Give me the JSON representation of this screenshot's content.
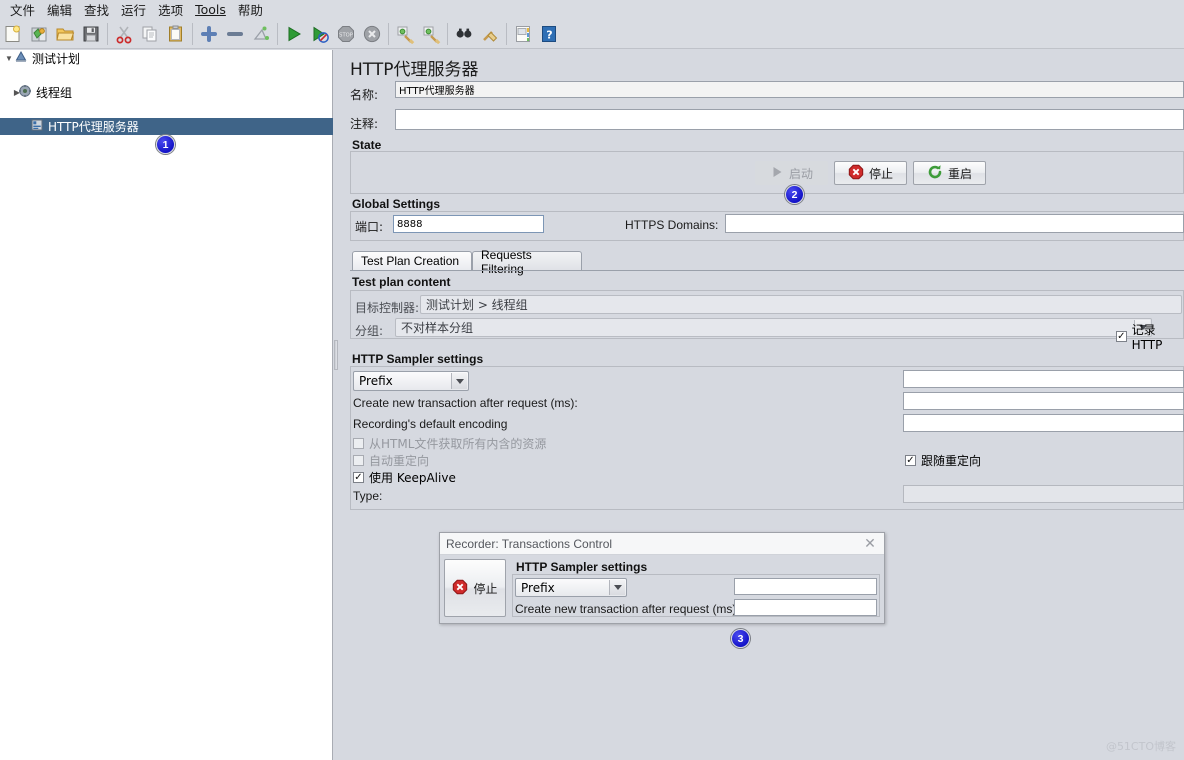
{
  "menu": {
    "items": [
      {
        "label": "文件"
      },
      {
        "label": "编辑"
      },
      {
        "label": "查找"
      },
      {
        "label": "运行"
      },
      {
        "label": "选项"
      },
      {
        "label": "Tools",
        "mnemonic": "T"
      },
      {
        "label": "帮助"
      }
    ]
  },
  "toolbar": {
    "buttons": [
      {
        "name": "new-icon",
        "title": "新建"
      },
      {
        "name": "templates-icon",
        "title": "模板"
      },
      {
        "name": "open-folder-icon",
        "title": "打开"
      },
      {
        "name": "save-icon",
        "title": "保存"
      },
      {
        "name": "cut-icon",
        "title": "剪切"
      },
      {
        "name": "copy-icon",
        "title": "复制"
      },
      {
        "name": "paste-icon",
        "title": "粘贴"
      },
      {
        "name": "expand-all-icon",
        "title": "展开"
      },
      {
        "name": "collapse-all-icon",
        "title": "收起"
      },
      {
        "name": "toggle-icon",
        "title": "切换"
      },
      {
        "name": "start-icon",
        "title": "启动"
      },
      {
        "name": "start-no-pauses-icon",
        "title": "无间隔启动"
      },
      {
        "name": "stop-icon",
        "title": "停止"
      },
      {
        "name": "shutdown-icon",
        "title": "关闭"
      },
      {
        "name": "clear-icon",
        "title": "清除"
      },
      {
        "name": "clear-all-icon",
        "title": "清除全部"
      },
      {
        "name": "search-icon",
        "title": "搜索"
      },
      {
        "name": "reset-search-icon",
        "title": "重置搜索"
      },
      {
        "name": "function-helper-icon",
        "title": "函数助手"
      },
      {
        "name": "help-icon",
        "title": "帮助"
      }
    ]
  },
  "tree": {
    "nodes": [
      {
        "label": "测试计划",
        "icon": "test-plan-icon",
        "level": 0,
        "expanded": true,
        "selected": false
      },
      {
        "label": "线程组",
        "icon": "thread-group-icon",
        "level": 1,
        "expanded": false,
        "selected": false
      },
      {
        "label": "HTTP代理服务器",
        "icon": "http-proxy-icon",
        "level": 2,
        "expanded": false,
        "selected": true,
        "badge": "1"
      }
    ]
  },
  "main": {
    "title": "HTTP代理服务器",
    "name_label": "名称:",
    "name_value": "HTTP代理服务器",
    "comment_label": "注释:",
    "comment_value": "",
    "state": {
      "group_title": "State",
      "start_label": "启动",
      "stop_label": "停止",
      "restart_label": "重启",
      "badge": "2"
    },
    "global": {
      "group_title": "Global Settings",
      "port_label": "端口:",
      "port_value": "8888",
      "https_domains_label": "HTTPS Domains:",
      "https_domains_value": ""
    },
    "tabs": [
      {
        "label": "Test Plan Creation",
        "active": true
      },
      {
        "label": "Requests Filtering",
        "active": false
      }
    ],
    "test_plan_content": {
      "group_title": "Test plan content",
      "target_controller_label": "目标控制器:",
      "target_controller_value": "测试计划 > 线程组",
      "grouping_label": "分组:",
      "grouping_value": "不对样本分组",
      "record_http_label": "记录HTTP",
      "record_http_checked": true
    },
    "sampler_settings": {
      "group_title": "HTTP Sampler settings",
      "prefix_value": "Prefix",
      "prefix_field_value": "",
      "transaction_label": "Create new transaction after request (ms):",
      "transaction_value": "",
      "encoding_label": "Recording's default encoding",
      "encoding_value": "",
      "retrieve_resources_label": "从HTML文件获取所有内含的资源",
      "retrieve_resources_checked": false,
      "auto_redirect_label": "自动重定向",
      "auto_redirect_checked": false,
      "follow_redirects_label": "跟随重定向",
      "follow_redirects_checked": true,
      "keepalive_label": "使用 KeepAlive",
      "keepalive_checked": true,
      "type_label": "Type:",
      "type_value": ""
    }
  },
  "dialog": {
    "title": "Recorder: Transactions Control",
    "close_icon": "✕",
    "stop_label": "停止",
    "group_title": "HTTP Sampler settings",
    "prefix_value": "Prefix",
    "prefix_field_value": "",
    "transaction_label": "Create new transaction after request (ms):",
    "transaction_value": "",
    "badge": "3"
  },
  "watermark": "@51CTO博客",
  "colors": {
    "selection": "#3f6488",
    "badge": "#1414c8",
    "panel": "#d6d9e0"
  }
}
